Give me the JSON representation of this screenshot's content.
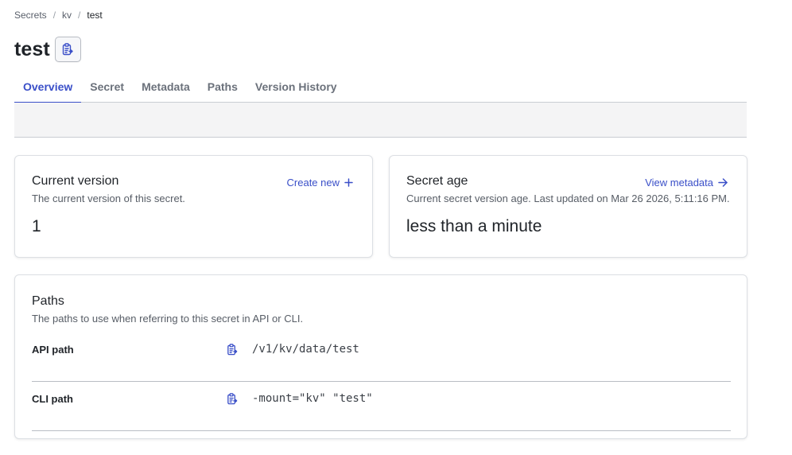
{
  "breadcrumb": {
    "items": [
      "Secrets",
      "kv"
    ],
    "separator": "/",
    "current": "test"
  },
  "page": {
    "title": "test",
    "copy_icon": "clipboard-copy-icon"
  },
  "tabs": [
    {
      "label": "Overview",
      "active": true
    },
    {
      "label": "Secret",
      "active": false
    },
    {
      "label": "Metadata",
      "active": false
    },
    {
      "label": "Paths",
      "active": false
    },
    {
      "label": "Version History",
      "active": false
    }
  ],
  "current_version": {
    "title": "Current version",
    "description": "The current version of this secret.",
    "value": "1",
    "link_label": "Create new",
    "link_icon": "plus-icon"
  },
  "secret_age": {
    "title": "Secret age",
    "description": "Current secret version age. Last updated on Mar 26 2026, 5:11:16 PM.",
    "value": "less than a minute",
    "link_label": "View metadata",
    "link_icon": "arrow-right-icon"
  },
  "paths": {
    "title": "Paths",
    "description": "The paths to use when referring to this secret in API or CLI.",
    "rows": [
      {
        "label": "API path",
        "value": "/v1/kv/data/test",
        "icon": "clipboard-copy-icon"
      },
      {
        "label": "CLI path",
        "value": "-mount=\"kv\" \"test\"",
        "icon": "clipboard-copy-icon"
      }
    ]
  },
  "colors": {
    "accent": "#3a4fc8",
    "muted_text": "#575d66",
    "border": "#dcdfe4",
    "strip_bg": "#f4f4f5"
  }
}
